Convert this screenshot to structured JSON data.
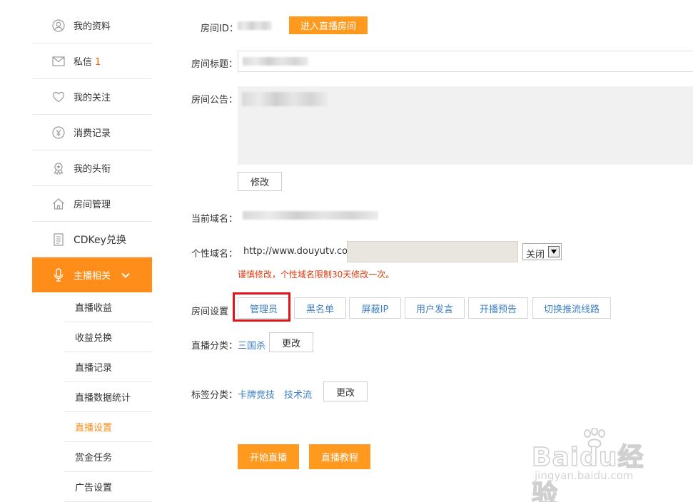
{
  "sidebar": {
    "items": [
      {
        "label": "我的资料",
        "icon": "user-icon"
      },
      {
        "label": "私信",
        "badge": "1",
        "icon": "mail-icon"
      },
      {
        "label": "我的关注",
        "icon": "heart-icon"
      },
      {
        "label": "消费记录",
        "icon": "yen-icon"
      },
      {
        "label": "我的头衔",
        "icon": "medal-icon"
      },
      {
        "label": "房间管理",
        "icon": "house-icon"
      },
      {
        "label": "CDKey兑换",
        "icon": "document-icon"
      },
      {
        "label": "主播相关",
        "icon": "microphone-icon"
      }
    ],
    "sub_items": [
      "直播收益",
      "收益兑换",
      "直播记录",
      "直播数据统计",
      "直播设置",
      "赏金任务",
      "广告设置"
    ],
    "current_sub": "直播设置"
  },
  "room": {
    "id_label": "房间ID：",
    "enter_button": "进入直播房间",
    "title_label": "房间标题：",
    "notice_label": "房间公告：",
    "modify_button": "修改",
    "domain_label": "当前域名：",
    "custom_domain_label": "个性域名：",
    "custom_domain_prefix": "http://www.douyutv.com/",
    "custom_domain_select": "关闭",
    "custom_domain_warning": "谨慎修改，个性域名限制30天修改一次。",
    "settings_label": "房间设置",
    "settings_tabs": [
      "管理员",
      "黑名单",
      "屏蔽IP",
      "用户发言",
      "开播预告",
      "切换推流线路"
    ],
    "category_label": "直播分类：",
    "category_value": "三国杀",
    "category_change": "更改",
    "tags_label": "标签分类：",
    "tags": [
      "卡牌竞技",
      "技术流"
    ],
    "tags_change": "更改",
    "start_button": "开始直播",
    "tutorial_button": "直播教程"
  },
  "watermark": {
    "main": "Baidu经验",
    "sub": "jingyan.baidu.com"
  },
  "colors": {
    "accent": "#ff8d1a",
    "button_orange": "#ff9a1e",
    "link": "#3d7fc4",
    "warning": "#e03a10",
    "highlight_box": "#e0151b"
  }
}
